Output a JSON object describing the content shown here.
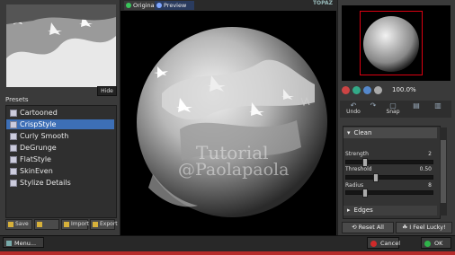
{
  "left": {
    "hide_label": "Hide",
    "presets_label": "Presets",
    "presets": [
      "Cartooned",
      "CrispStyle",
      "Curly Smooth",
      "DeGrunge",
      "FlatStyle",
      "SkinEven",
      "Stylize Details"
    ],
    "active_preset_index": 1,
    "tools": {
      "save": "Save",
      "import": "Import",
      "export": "Export"
    }
  },
  "center": {
    "tabs": {
      "original": "Original",
      "preview": "Preview"
    },
    "logo": "TOPAZ",
    "watermark_line1": "Tutorial",
    "watermark_line2": "@Paolapaola"
  },
  "right": {
    "zoom_value": "100.0%",
    "undo": "Undo",
    "snap": "Snap",
    "section_clean": "Clean",
    "sliders": [
      {
        "label": "Strength",
        "value": "2",
        "level": 0.2
      },
      {
        "label": "Threshold",
        "value": "0.50",
        "level": 0.33
      },
      {
        "label": "Radius",
        "value": "8",
        "level": 0.2
      }
    ],
    "section_edges": "Edges",
    "reset_all": "Reset All",
    "feel_lucky": "I Feel Lucky!"
  },
  "bottom": {
    "menu": "Menu...",
    "cancel": "Cancel",
    "ok": "OK"
  },
  "colors": {
    "accent": "#3d6fb6",
    "nav_frame": "#dd1111",
    "cancel": "#d02a2a",
    "ok": "#2fb34a",
    "bottom_strip": "#b62b2b"
  }
}
